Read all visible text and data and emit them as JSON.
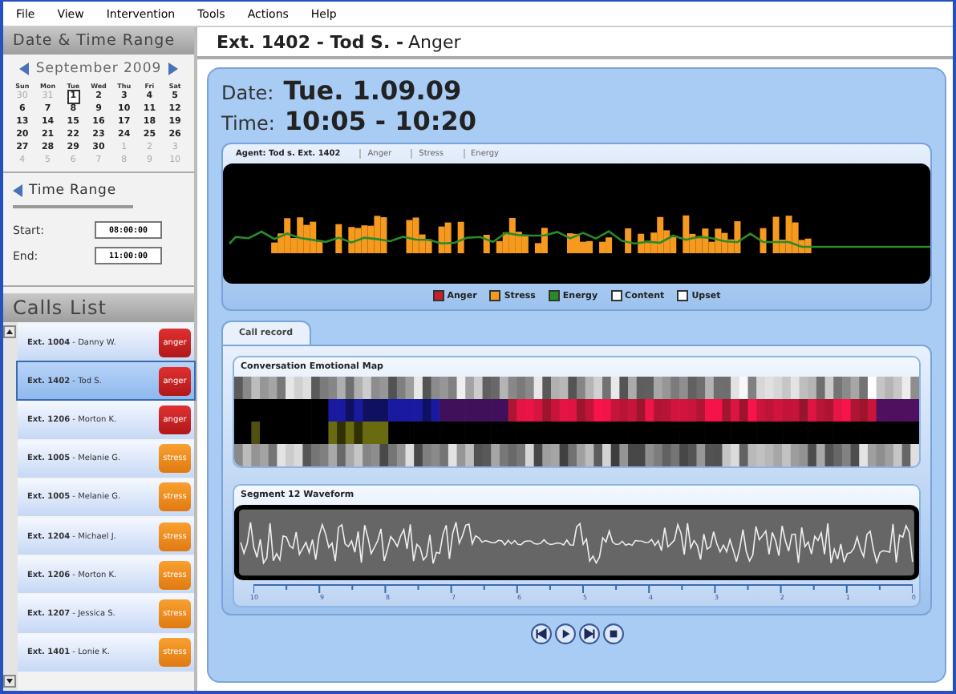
{
  "menu": [
    "File",
    "View",
    "Intervention",
    "Tools",
    "Actions",
    "Help"
  ],
  "date_range": {
    "title": "Date & Time Range",
    "month": "September 2009",
    "weekdays": [
      "Sun",
      "Mon",
      "Tue",
      "Wed",
      "Thu",
      "Fri",
      "Sat"
    ],
    "days": [
      {
        "label": "30",
        "muted": true,
        "selected": false
      },
      {
        "label": "31",
        "muted": true,
        "selected": false
      },
      {
        "label": "1",
        "muted": false,
        "selected": true
      },
      {
        "label": "2",
        "muted": false,
        "selected": false
      },
      {
        "label": "3",
        "muted": false,
        "selected": false
      },
      {
        "label": "4",
        "muted": false,
        "selected": false
      },
      {
        "label": "5",
        "muted": false,
        "selected": false
      },
      {
        "label": "6",
        "muted": false,
        "selected": false
      },
      {
        "label": "7",
        "muted": false,
        "selected": false
      },
      {
        "label": "8",
        "muted": false,
        "selected": false
      },
      {
        "label": "9",
        "muted": false,
        "selected": false
      },
      {
        "label": "10",
        "muted": false,
        "selected": false
      },
      {
        "label": "11",
        "muted": false,
        "selected": false
      },
      {
        "label": "12",
        "muted": false,
        "selected": false
      },
      {
        "label": "13",
        "muted": false,
        "selected": false
      },
      {
        "label": "14",
        "muted": false,
        "selected": false
      },
      {
        "label": "15",
        "muted": false,
        "selected": false
      },
      {
        "label": "16",
        "muted": false,
        "selected": false
      },
      {
        "label": "17",
        "muted": false,
        "selected": false
      },
      {
        "label": "18",
        "muted": false,
        "selected": false
      },
      {
        "label": "19",
        "muted": false,
        "selected": false
      },
      {
        "label": "20",
        "muted": false,
        "selected": false
      },
      {
        "label": "21",
        "muted": false,
        "selected": false
      },
      {
        "label": "22",
        "muted": false,
        "selected": false
      },
      {
        "label": "23",
        "muted": false,
        "selected": false
      },
      {
        "label": "24",
        "muted": false,
        "selected": false
      },
      {
        "label": "25",
        "muted": false,
        "selected": false
      },
      {
        "label": "26",
        "muted": false,
        "selected": false
      },
      {
        "label": "27",
        "muted": false,
        "selected": false
      },
      {
        "label": "28",
        "muted": false,
        "selected": false
      },
      {
        "label": "29",
        "muted": false,
        "selected": false
      },
      {
        "label": "30",
        "muted": false,
        "selected": false
      },
      {
        "label": "1",
        "muted": true,
        "selected": false
      },
      {
        "label": "2",
        "muted": true,
        "selected": false
      },
      {
        "label": "3",
        "muted": true,
        "selected": false
      },
      {
        "label": "4",
        "muted": true,
        "selected": false
      },
      {
        "label": "5",
        "muted": true,
        "selected": false
      },
      {
        "label": "6",
        "muted": true,
        "selected": false
      },
      {
        "label": "7",
        "muted": true,
        "selected": false
      },
      {
        "label": "8",
        "muted": true,
        "selected": false
      },
      {
        "label": "9",
        "muted": true,
        "selected": false
      },
      {
        "label": "10",
        "muted": true,
        "selected": false
      }
    ]
  },
  "time_range": {
    "title": "Time Range",
    "start_label": "Start:",
    "start": "08:00:00",
    "end_label": "End:",
    "end": "11:00:00"
  },
  "calls_list": {
    "title": "Calls List",
    "rows": [
      {
        "caller": "**Ext. 1004** - Danny W.",
        "badge": "anger",
        "kind": "anger",
        "selected": false
      },
      {
        "caller": "**Ext. 1402** - Tod S.",
        "badge": "anger",
        "kind": "anger",
        "selected": true
      },
      {
        "caller": "**Ext. 1206** - Morton K.",
        "badge": "anger",
        "kind": "anger",
        "selected": false
      },
      {
        "caller": "**Ext. 1005** - Melanie G.",
        "badge": "stress",
        "kind": "stress",
        "selected": false
      },
      {
        "caller": "**Ext. 1005** - Melanie G.",
        "badge": "stress",
        "kind": "stress",
        "selected": false
      },
      {
        "caller": "**Ext. 1204** - Michael J.",
        "badge": "stress",
        "kind": "stress",
        "selected": false
      },
      {
        "caller": "**Ext. 1206** - Morton K.",
        "badge": "stress",
        "kind": "stress",
        "selected": false
      },
      {
        "caller": "**Ext. 1207** - Jessica S.",
        "badge": "stress",
        "kind": "stress",
        "selected": false
      },
      {
        "caller": "**Ext. 1401** - Lonie K.",
        "badge": "stress",
        "kind": "stress",
        "selected": false
      }
    ]
  },
  "detail": {
    "title": "**Ext. 1402 - Tod S. -** Anger",
    "date_label": "Date:",
    "date": "Tue. 1.09.09",
    "time_label": "Time:",
    "time": "10:05 - 10:20",
    "agent_chart": {
      "columns": [
        "Agent: Tod s. Ext. 1402",
        "Anger",
        "Stress",
        "Energy"
      ],
      "legend": [
        {
          "label": "Anger",
          "color": "#c8202a"
        },
        {
          "label": "Stress",
          "color": "#f59a1e"
        },
        {
          "label": "Energy",
          "color": "#2a8a2a"
        },
        {
          "label": "Content",
          "color": "#ffffff"
        },
        {
          "label": "Upset",
          "color": "#ffffff"
        }
      ]
    },
    "tabs": [
      {
        "label": "Call record",
        "selected": true
      }
    ],
    "emotional_map": {
      "title": "Conversation Emotional Map"
    },
    "waveform": {
      "title": "Segment 12 Waveform",
      "tick_labels": [
        "10",
        "9",
        "8",
        "7",
        "6",
        "5",
        "4",
        "3",
        "2",
        "1",
        "0"
      ]
    }
  }
}
